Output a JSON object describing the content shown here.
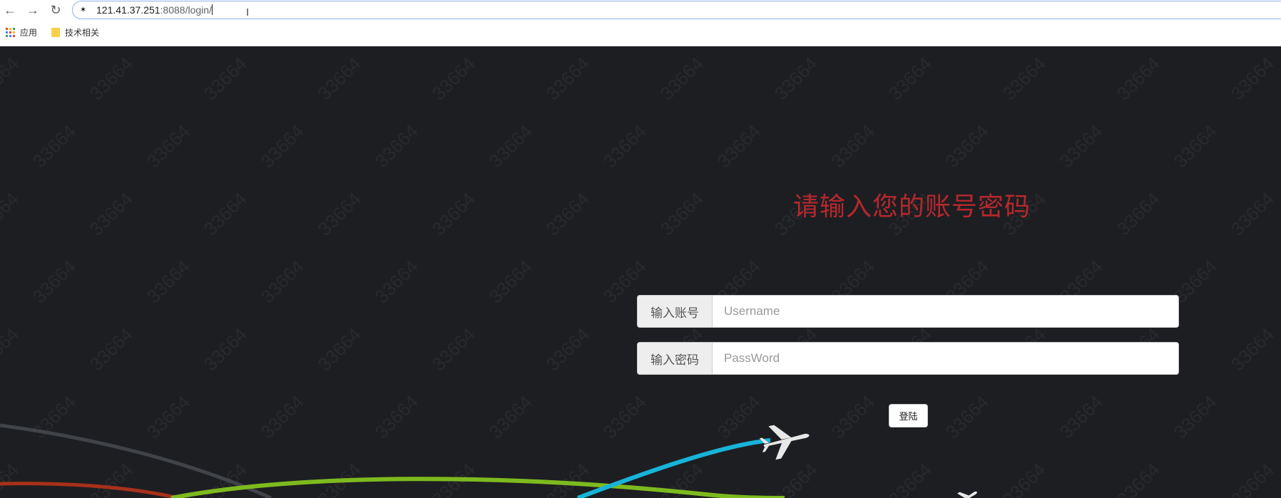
{
  "browser": {
    "url_host": "121.41.37.251",
    "url_rest": ":8088/login/",
    "bookmarks": [
      {
        "label": "应用",
        "icon": "apps-grid-icon"
      },
      {
        "label": "技术相关",
        "icon": "folder-icon"
      }
    ]
  },
  "page": {
    "watermark_text": "33664",
    "heading": "请输入您的账号密码",
    "username": {
      "addon": "输入账号",
      "placeholder": "Username",
      "value": ""
    },
    "password": {
      "addon": "输入密码",
      "placeholder": "PassWord",
      "value": ""
    },
    "login_button": "登陆"
  },
  "colors": {
    "background": "#1d1e22",
    "heading": "#b5282c",
    "trail_blue": "#17b4d9",
    "trail_green": "#7dba1e",
    "trail_red": "#a8301a",
    "trail_gray": "#4a4c52"
  }
}
